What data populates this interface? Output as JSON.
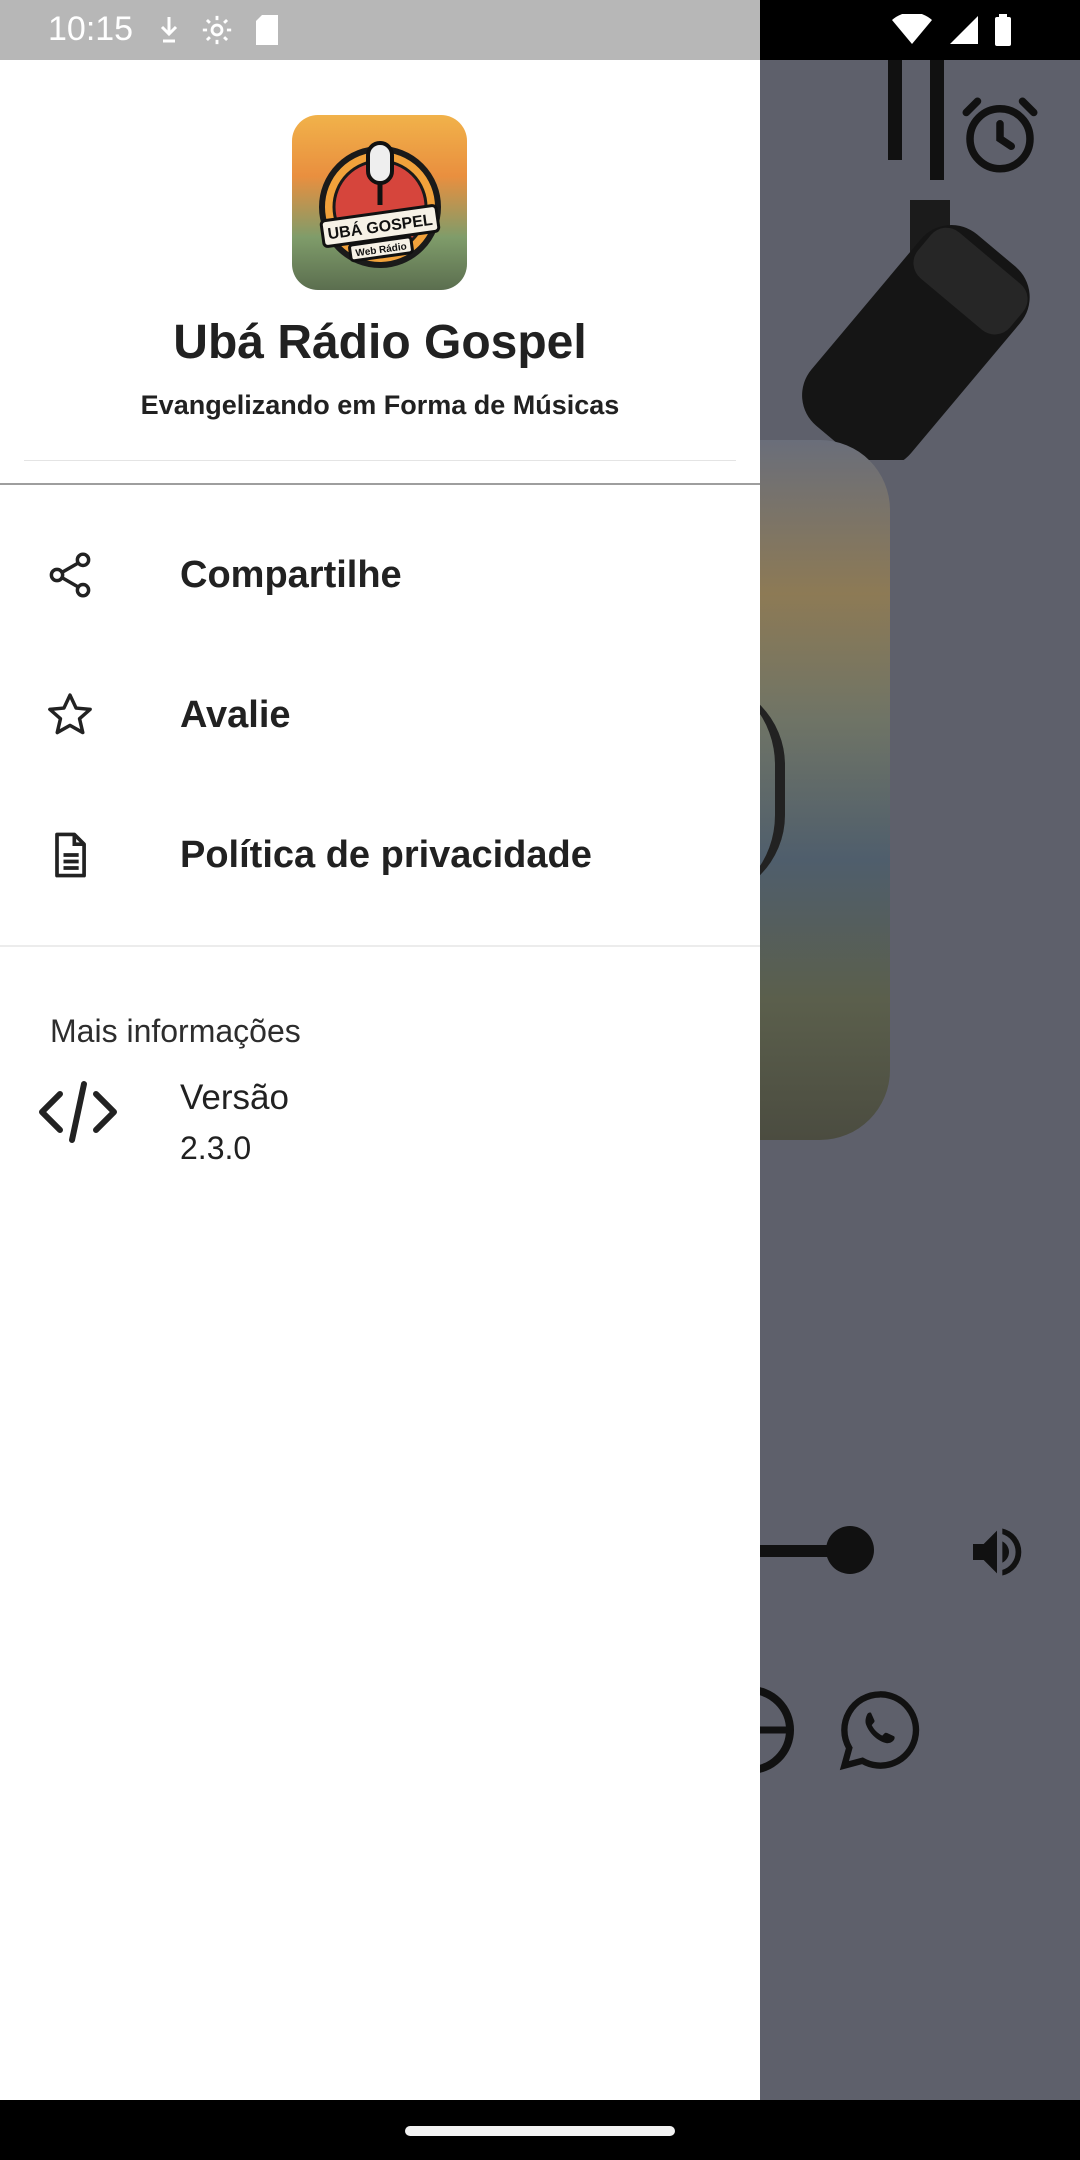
{
  "status_bar": {
    "time": "10:15",
    "left_icons": [
      "download-arrow-icon",
      "settings-gear-icon",
      "sd-card-icon"
    ],
    "right_icons": [
      "wifi-icon",
      "signal-icon",
      "battery-icon"
    ]
  },
  "drawer": {
    "header": {
      "app_name": "Ubá Rádio Gospel",
      "tagline": "Evangelizando em Forma de Músicas",
      "logo_text": "UBÁ GOSPEL",
      "logo_subtext": "Web Rádio"
    },
    "menu": [
      {
        "label": "Compartilhe",
        "icon": "share-icon"
      },
      {
        "label": "Avalie",
        "icon": "star-icon"
      },
      {
        "label": "Política de privacidade",
        "icon": "document-icon"
      }
    ],
    "info_section": {
      "title": "Mais informações",
      "items": [
        {
          "title": "Versão",
          "value": "2.3.0",
          "icon": "code-icon"
        }
      ]
    }
  },
  "background_app": {
    "icons": [
      "microphone-image",
      "alarm-clock-icon",
      "volume-icon",
      "globe-icon",
      "whatsapp-icon"
    ],
    "volume_level": 1.0
  },
  "colors": {
    "drawer_bg": "#ffffff",
    "text_primary": "#212121",
    "scrim": "#5e606b",
    "status_bar_left": "#b7b7b7"
  }
}
